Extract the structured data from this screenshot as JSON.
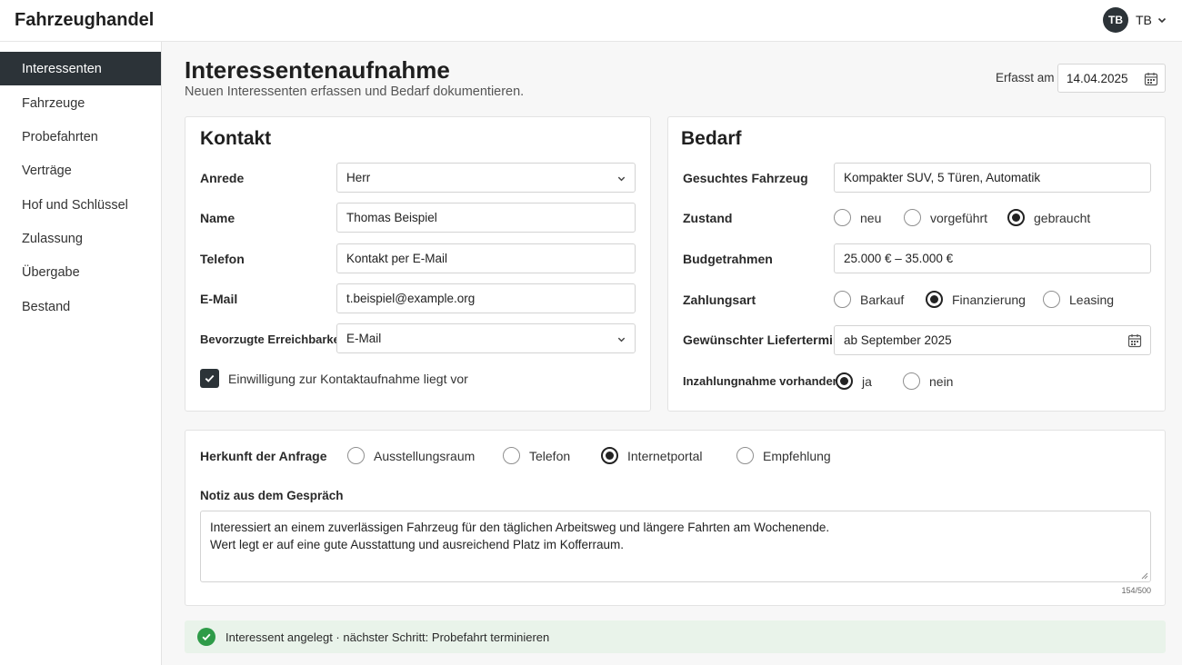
{
  "app": {
    "title": "Fahrzeughandel"
  },
  "user": {
    "initials": "TB",
    "label": "TB"
  },
  "sidebar": {
    "items": [
      {
        "label": "Interessenten",
        "active": true
      },
      {
        "label": "Fahrzeuge"
      },
      {
        "label": "Probefahrten"
      },
      {
        "label": "Verträge"
      },
      {
        "label": "Hof und Schlüssel"
      },
      {
        "label": "Zulassung"
      },
      {
        "label": "Übergabe"
      },
      {
        "label": "Bestand"
      }
    ]
  },
  "page": {
    "title": "Interessentenaufnahme",
    "subtitle": "Neuen Interessenten erfassen und Bedarf dokumentieren.",
    "date_label": "Erfasst am",
    "date_value": "14.04.2025"
  },
  "kontakt": {
    "title": "Kontakt",
    "anrede": {
      "label": "Anrede",
      "value": "Herr"
    },
    "name": {
      "label": "Name",
      "value": "Thomas Beispiel"
    },
    "telefon": {
      "label": "Telefon",
      "value": "Kontakt per E-Mail"
    },
    "email": {
      "label": "E-Mail",
      "value": "t.beispiel@example.org"
    },
    "erreichbarkeit": {
      "label": "Bevorzugte Erreichbarkeit",
      "value": "E-Mail"
    },
    "consent": {
      "label": "Einwilligung zur Kontaktaufnahme liegt vor",
      "checked": true
    }
  },
  "bedarf": {
    "title": "Bedarf",
    "fahrzeug": {
      "label": "Gesuchtes Fahrzeug",
      "value": "Kompakter SUV, 5 Türen, Automatik"
    },
    "zustand": {
      "label": "Zustand",
      "options": [
        "neu",
        "vorgeführt",
        "gebraucht"
      ],
      "selected": "gebraucht"
    },
    "budget": {
      "label": "Budgetrahmen",
      "value": "25.000 € – 35.000 €"
    },
    "zahlungsart": {
      "label": "Zahlungsart",
      "options": [
        "Barkauf",
        "Finanzierung",
        "Leasing"
      ],
      "selected": "Finanzierung"
    },
    "liefertermin": {
      "label": "Gewünschter Liefertermin",
      "value": "ab September 2025"
    },
    "inzahlungnahme": {
      "label": "Inzahlungnahme vorhanden",
      "options": [
        "ja",
        "nein"
      ],
      "selected": "ja"
    }
  },
  "herkunft": {
    "label": "Herkunft der Anfrage",
    "options": [
      "Ausstellungsraum",
      "Telefon",
      "Internetportal",
      "Empfehlung"
    ],
    "selected": "Internetportal"
  },
  "notiz": {
    "label": "Notiz aus dem Gespräch",
    "line1": "Interessiert an einem zuverlässigen Fahrzeug für den täglichen Arbeitsweg und längere Fahrten am Wochenende.",
    "line2": "Wert legt er auf eine gute Ausstattung und ausreichend Platz im Kofferraum.",
    "counter": "154/500"
  },
  "status": {
    "text": "Interessent angelegt · nächster Schritt: Probefahrt terminieren"
  },
  "colors": {
    "accent": "#2c3338",
    "success": "#2e9b48",
    "success_bg": "#e9f3ea"
  },
  "icons": {
    "calendar": "calendar-icon",
    "chevron": "chevron-down-icon",
    "check": "check-icon"
  }
}
